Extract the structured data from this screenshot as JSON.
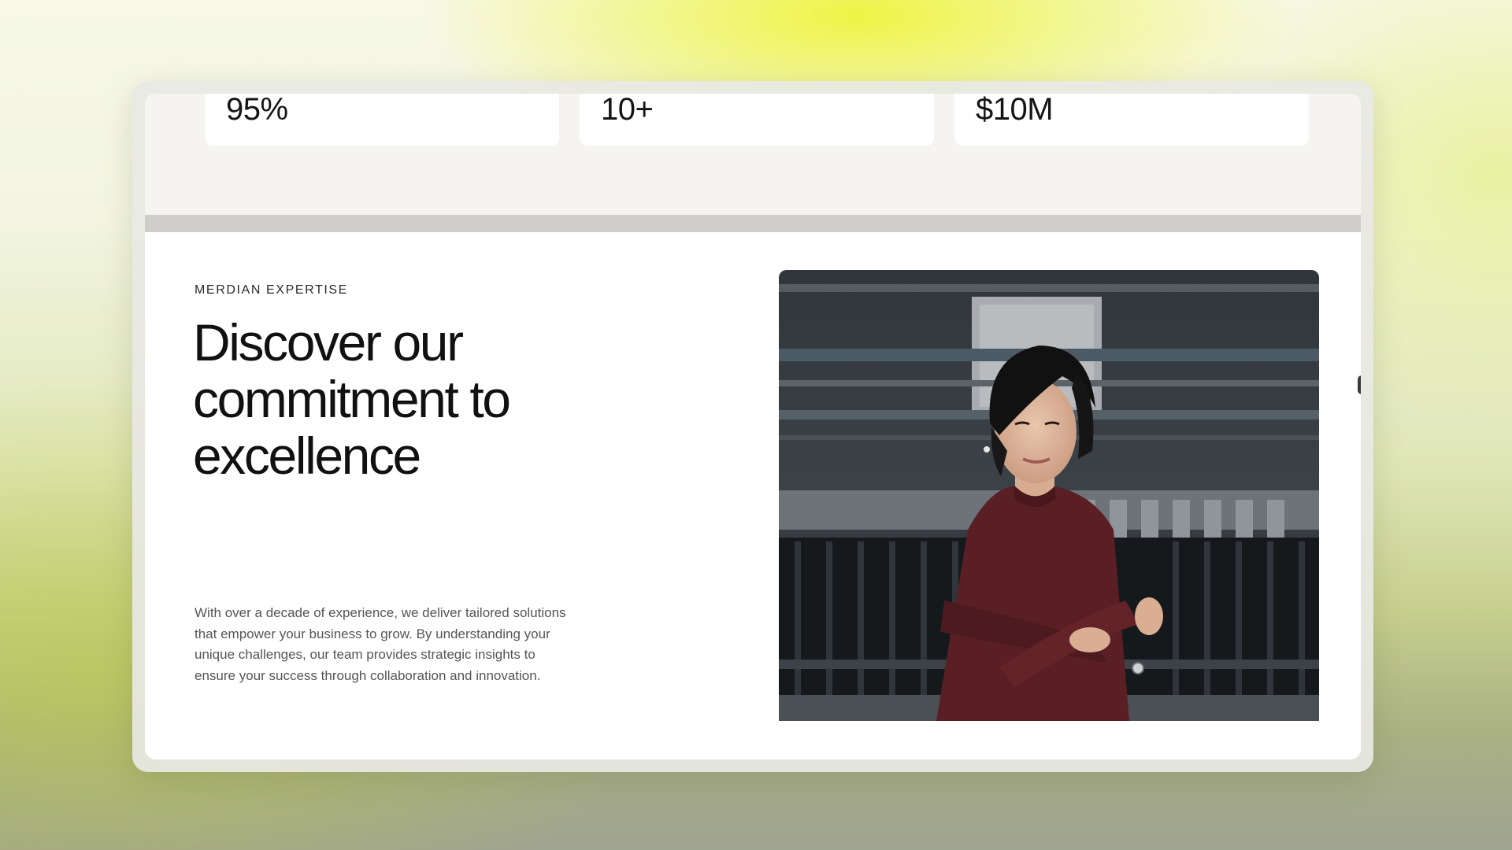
{
  "stats": [
    {
      "value": "95%"
    },
    {
      "value": "10+"
    },
    {
      "value": "$10M"
    }
  ],
  "expertise": {
    "eyebrow": "MERDIAN EXPERTISE",
    "headline": "Discover our commitment to excellence",
    "description": "With over a decade of experience, we deliver tailored solutions that empower your business to grow. By understanding your unique challenges, our team provides strategic insights to ensure your success through collaboration and innovation."
  },
  "colors": {
    "accent_glow": "#eef43c",
    "sweater": "#5a1f24",
    "text_dark": "#111111",
    "text_muted": "#555555"
  }
}
